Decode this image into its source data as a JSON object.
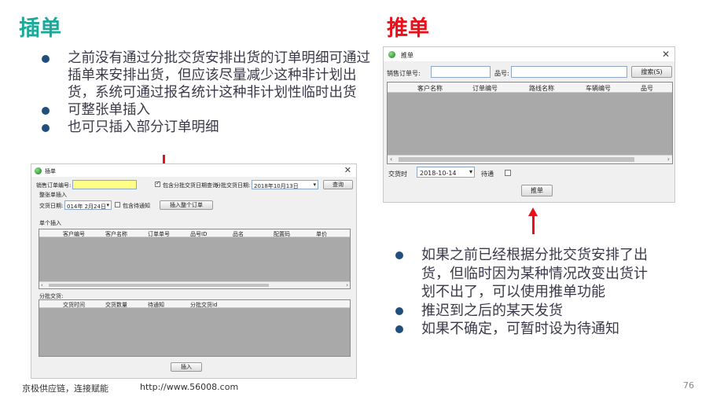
{
  "slide": {
    "title_left": "插单",
    "title_right": "推单",
    "bullets_left": [
      "之前没有通过分批交货安排出货的订单明细可通过插单来安排出货，但应该尽量减少这种非计划出货，系统可通过报名统计这种非计划性临时出货",
      "可整张单插入",
      "也可只插入部分订单明细"
    ],
    "bullets_right": [
      "如果之前已经根据分批交货安排了出货，但临时因为某种情况改变出货计划不出了，可以使用推单功能",
      "推迟到之后的某天发货",
      "如果不确定，可暂时设为待通知"
    ],
    "footer_company": "京极供应链，连接赋能",
    "footer_url": "http://www.56008.com",
    "page_number": "76",
    "accent_color_left": "#1aa99a",
    "accent_color_right": "#e8101b"
  },
  "insert_window": {
    "title": "插单",
    "order_no_label": "销售订单编号:",
    "include_batch_label": "包含分批交货日期查询",
    "batch_date_label": "分批交货日期:",
    "batch_date_value": "2018年10月13日",
    "query_button": "查询",
    "whole_insert_label": "整张单插入",
    "delivery_date_label": "交货日期:",
    "delivery_date_value": "014年 2月24日",
    "include_pending_label": "包含待通知",
    "insert_whole_button": "插入整个订单",
    "single_insert_label": "单个插入",
    "grid1_columns": [
      "客户编号",
      "客户名称",
      "订单单号",
      "品号ID",
      "品名",
      "配置码",
      "单价"
    ],
    "batch_label": "分批交货:",
    "grid2_columns": [
      "交货时间",
      "交货数量",
      "待通知",
      "分批交货id"
    ],
    "insert_button": "插入"
  },
  "push_window": {
    "title": "推单",
    "order_no_label": "销售订单号:",
    "product_label": "品号:",
    "search_button": "搜索(S)",
    "grid_columns": [
      "客户名称",
      "订单编号",
      "路线名称",
      "车辆编号",
      "品号"
    ],
    "delivery_label": "交货时",
    "delivery_value": "2018-10-14",
    "pending_label": "待通",
    "push_button": "推单"
  }
}
